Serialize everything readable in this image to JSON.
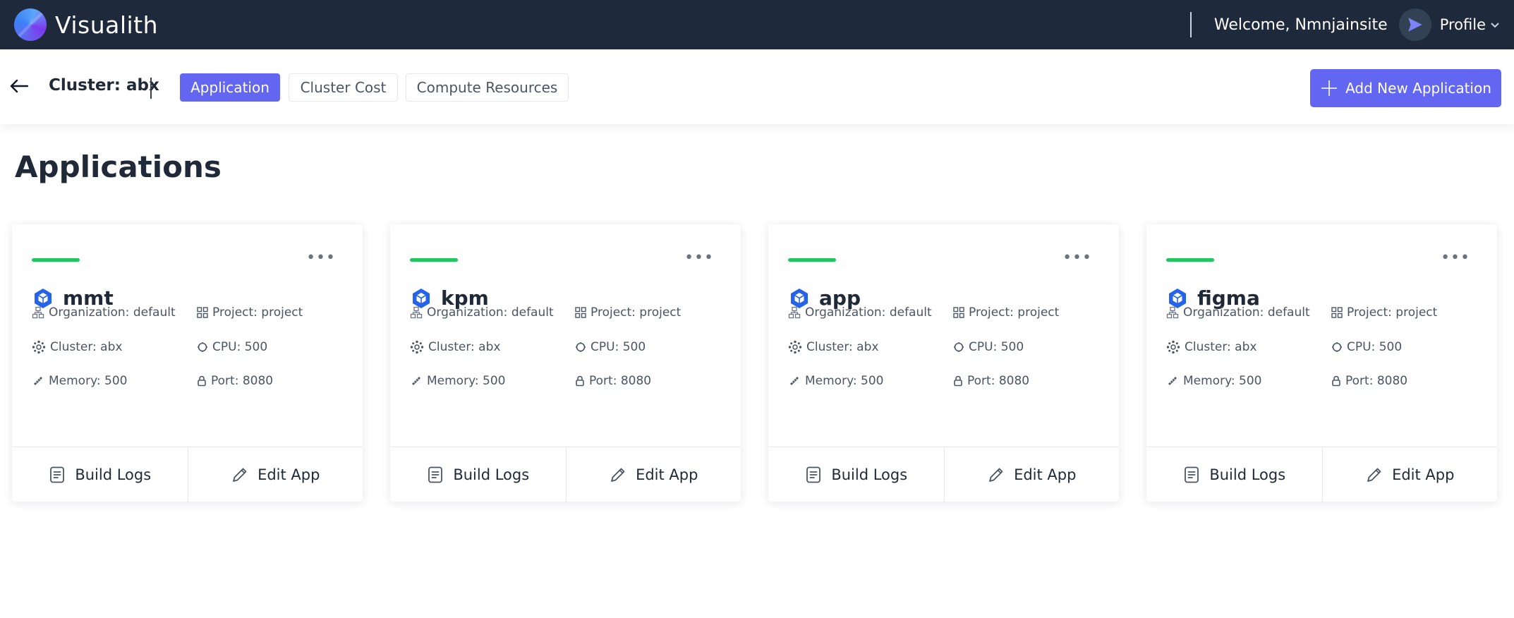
{
  "topbar": {
    "brand": "Visualith",
    "welcome": "Welcome, Nmnjainsite",
    "profile_label": "Profile"
  },
  "subheader": {
    "cluster_title": "Cluster: abx",
    "tabs": [
      {
        "label": "Application",
        "active": true
      },
      {
        "label": "Cluster Cost",
        "active": false
      },
      {
        "label": "Compute Resources",
        "active": false
      }
    ],
    "add_button": "Add New Application"
  },
  "page_title": "Applications",
  "colors": {
    "accent": "#6366f1",
    "topbar_bg": "#1e293b",
    "status_green": "#22c55e",
    "app_icon_blue": "#2563eb"
  },
  "apps": [
    {
      "name": "mmt",
      "organization": "Organization: default",
      "project": "Project: project",
      "cluster": "Cluster: abx",
      "cpu": "CPU: 500",
      "memory": "Memory: 500",
      "port": "Port: 8080",
      "build_logs": "Build Logs",
      "edit_app": "Edit App"
    },
    {
      "name": "kpm",
      "organization": "Organization: default",
      "project": "Project: project",
      "cluster": "Cluster: abx",
      "cpu": "CPU: 500",
      "memory": "Memory: 500",
      "port": "Port: 8080",
      "build_logs": "Build Logs",
      "edit_app": "Edit App"
    },
    {
      "name": "app",
      "organization": "Organization: default",
      "project": "Project: project",
      "cluster": "Cluster: abx",
      "cpu": "CPU: 500",
      "memory": "Memory: 500",
      "port": "Port: 8080",
      "build_logs": "Build Logs",
      "edit_app": "Edit App"
    },
    {
      "name": "figma",
      "organization": "Organization: default",
      "project": "Project: project",
      "cluster": "Cluster: abx",
      "cpu": "CPU: 500",
      "memory": "Memory: 500",
      "port": "Port: 8080",
      "build_logs": "Build Logs",
      "edit_app": "Edit App"
    }
  ]
}
